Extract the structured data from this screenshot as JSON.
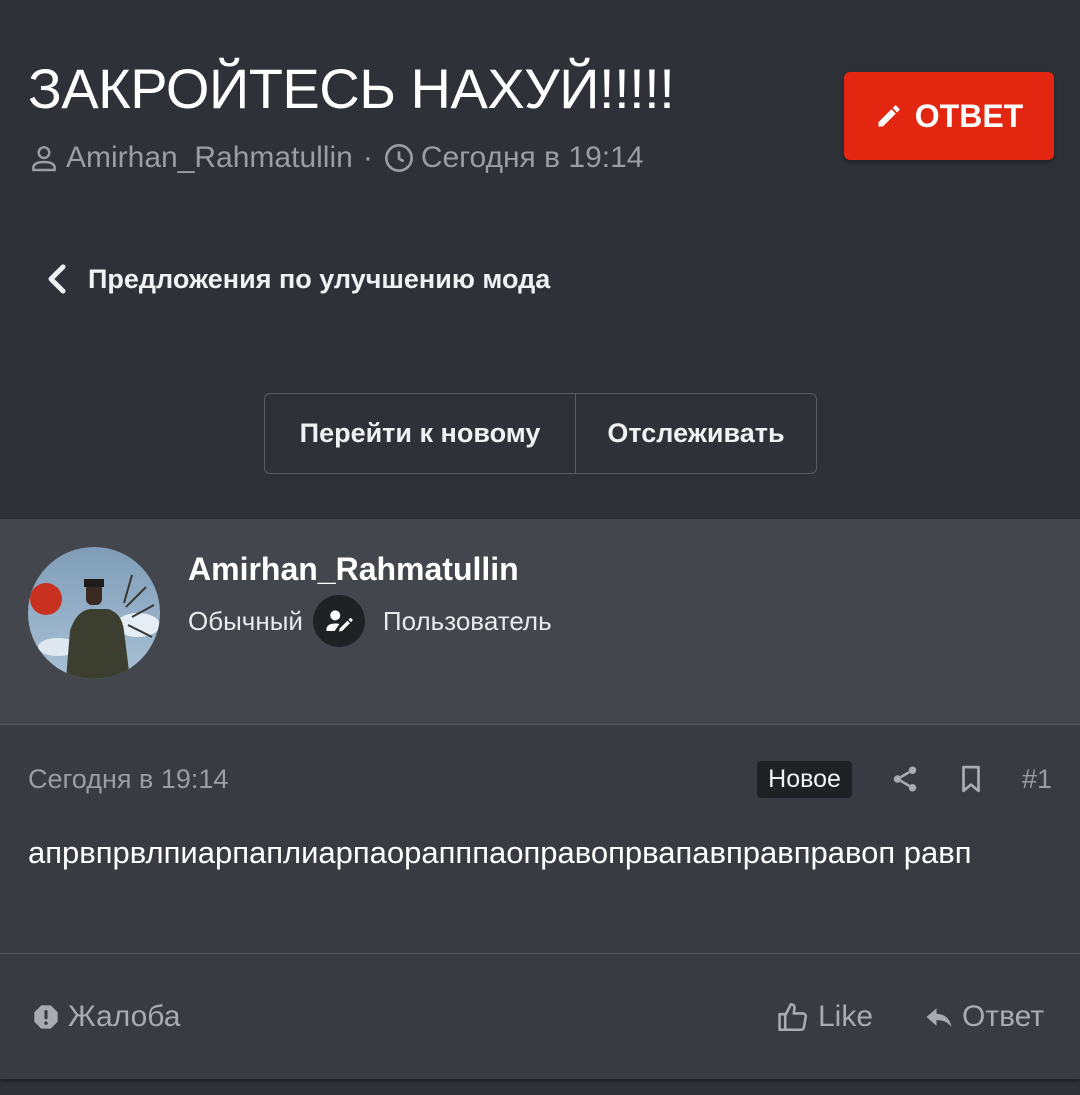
{
  "thread": {
    "title": "ЗАКРОЙТЕСЬ НАХУЙ!!!!!",
    "author": "Amirhan_Rahmatullin",
    "separator": "·",
    "date": "Сегодня в 19:14",
    "reply_button": "ОТВЕТ"
  },
  "breadcrumb": {
    "label": "Предложения по улучшению мода"
  },
  "actions": {
    "goto_new": "Перейти к новому",
    "watch": "Отслеживать"
  },
  "post": {
    "username": "Amirhan_Rahmatullin",
    "rank": "Обычный",
    "role": "Пользователь",
    "date": "Сегодня в 19:14",
    "new_badge": "Новое",
    "number": "#1",
    "body": "апрвпрвлпиарпаплиарпаорапппаоправопрвапавправправоп равп",
    "report": "Жалоба",
    "like": "Like",
    "reply": "Ответ"
  },
  "icons": {
    "reply_button": "pencil-icon",
    "author": "user-icon",
    "date": "clock-icon",
    "breadcrumb": "chevron-left-icon",
    "role": "user-edit-icon",
    "share": "share-icon",
    "bookmark": "bookmark-icon",
    "report": "exclamation-octagon-icon",
    "like": "thumbs-up-icon",
    "reply": "reply-arrow-icon"
  },
  "colors": {
    "background": "#2e3138",
    "post_background": "#383b42",
    "user_block": "#43464d",
    "accent": "#e3260f",
    "muted_text": "#9a9da3"
  }
}
